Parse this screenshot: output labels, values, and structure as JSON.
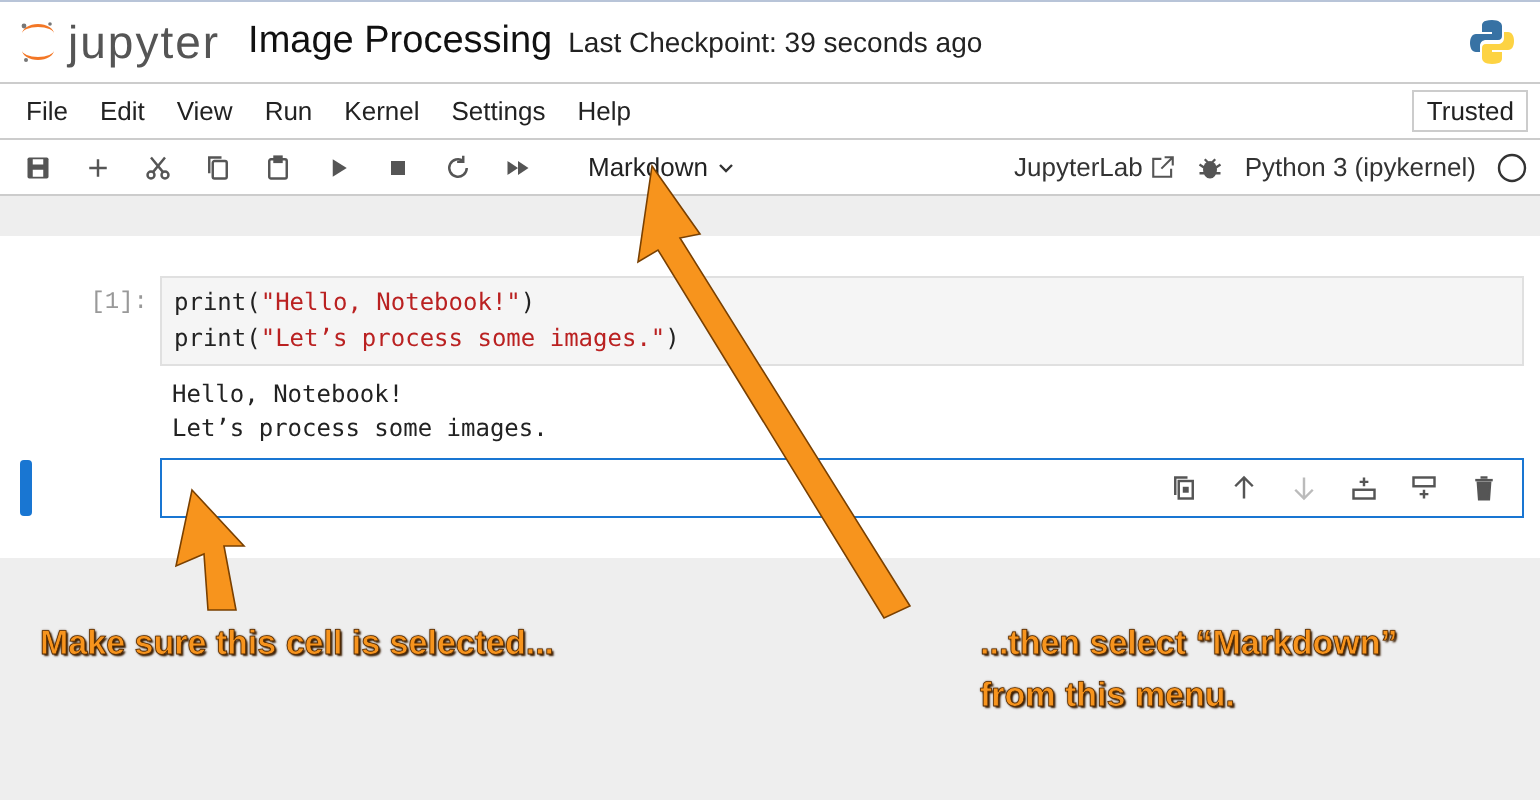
{
  "header": {
    "logo_text": "jupyter",
    "title": "Image Processing",
    "checkpoint": "Last Checkpoint: 39 seconds ago"
  },
  "menu": {
    "items": [
      "File",
      "Edit",
      "View",
      "Run",
      "Kernel",
      "Settings",
      "Help"
    ],
    "trusted": "Trusted"
  },
  "toolbar": {
    "cell_type": "Markdown",
    "jupyterlab": "JupyterLab",
    "kernel": "Python 3 (ipykernel)"
  },
  "cells": [
    {
      "kind": "code",
      "selected": false,
      "prompt": "[1]:",
      "code": [
        [
          {
            "kind": "plain",
            "text": "print("
          },
          {
            "kind": "string",
            "text": "\"Hello, Notebook!\""
          },
          {
            "kind": "plain",
            "text": ")"
          }
        ],
        [
          {
            "kind": "plain",
            "text": "print("
          },
          {
            "kind": "string",
            "text": "\"Let’s process some images.\""
          },
          {
            "kind": "plain",
            "text": ")"
          }
        ]
      ],
      "output": [
        "Hello, Notebook!",
        "Let’s process some images."
      ]
    },
    {
      "kind": "empty",
      "selected": true,
      "actions": [
        {
          "kind": "duplicate",
          "disabled": false
        },
        {
          "kind": "up",
          "disabled": false
        },
        {
          "kind": "down",
          "disabled": true
        },
        {
          "kind": "insert-above",
          "disabled": false
        },
        {
          "kind": "insert-below",
          "disabled": false
        },
        {
          "kind": "delete",
          "disabled": false
        }
      ]
    }
  ],
  "annotations": [
    "Make sure this cell is selected...",
    "...then select “Markdown” from this menu."
  ]
}
